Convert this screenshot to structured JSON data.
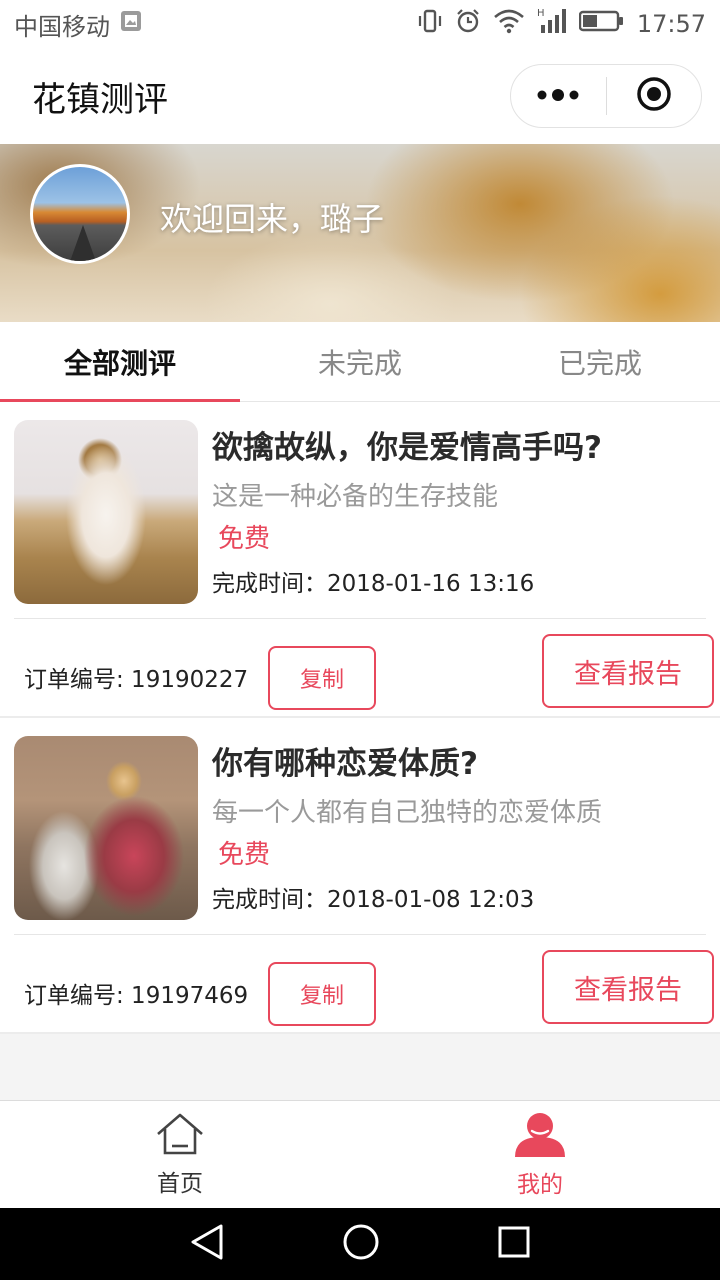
{
  "status_bar": {
    "carrier": "中国移动",
    "time": "17:57",
    "icons": [
      "image-notification-icon",
      "vibrate-icon",
      "alarm-icon",
      "wifi-icon",
      "signal-icon",
      "battery-icon"
    ]
  },
  "nav": {
    "title": "花镇测评",
    "capsule_icons": [
      "more-dots-icon",
      "close-target-icon"
    ]
  },
  "banner": {
    "welcome": "欢迎回来，璐子"
  },
  "tabs": [
    {
      "label": "全部测评",
      "active": true
    },
    {
      "label": "未完成",
      "active": false
    },
    {
      "label": "已完成",
      "active": false
    }
  ],
  "cards": [
    {
      "title": "欲擒故纵，你是爱情高手吗?",
      "subtitle": "这是一种必备的生存技能",
      "price": "免费",
      "time": "完成时间：2018-01-16 13:16",
      "order": "订单编号: 19190227",
      "copy_label": "复制",
      "report_label": "查看报告"
    },
    {
      "title": "你有哪种恋爱体质?",
      "subtitle": "每一个人都有自己独特的恋爱体质",
      "price": "免费",
      "time": "完成时间：2018-01-08 12:03",
      "order": "订单编号: 19197469",
      "copy_label": "复制",
      "report_label": "查看报告"
    }
  ],
  "tabbar": [
    {
      "label": "首页",
      "icon": "home-icon",
      "active": false
    },
    {
      "label": "我的",
      "icon": "user-icon",
      "active": true
    }
  ],
  "colors": {
    "accent": "#e8485c",
    "background": "#f4f4f4"
  }
}
